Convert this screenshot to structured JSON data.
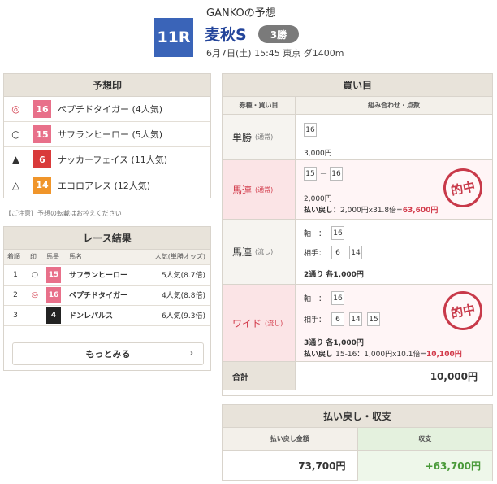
{
  "header": {
    "title": "GANKOの予想",
    "race_number": "11R",
    "race_name": "麦秋S",
    "grade": "3勝",
    "info": "6月7日(土) 15:45 東京 ダ1400m"
  },
  "yoso": {
    "heading": "予想印",
    "rows": [
      {
        "mark": "◎",
        "num": "16",
        "horse": "ペプチドタイガー",
        "pop": "(4人気)"
      },
      {
        "mark": "○",
        "num": "15",
        "horse": "サフランヒーロー",
        "pop": "(5人気)"
      },
      {
        "mark": "▲",
        "num": "6",
        "horse": "ナッカーフェイス",
        "pop": "(11人気)"
      },
      {
        "mark": "△",
        "num": "14",
        "horse": "エコロアレス",
        "pop": "(12人気)"
      }
    ]
  },
  "notice": "【ご注意】予想の転載はお控えください",
  "result": {
    "heading": "レース結果",
    "cols": [
      "着順",
      "印",
      "馬番",
      "馬名",
      "人気(単勝オッズ)"
    ],
    "rows": [
      {
        "rank": "1",
        "mark": "○",
        "num": "15",
        "horse": "サフランヒーロー",
        "pop": "5人気(8.7倍)"
      },
      {
        "rank": "2",
        "mark": "◎",
        "num": "16",
        "horse": "ペプチドタイガー",
        "pop": "4人気(8.8倍)"
      },
      {
        "rank": "3",
        "mark": "",
        "num": "4",
        "horse": "ドンレパルス",
        "pop": "6人気(9.3倍)"
      }
    ],
    "more_label": "もっとみる"
  },
  "kaime": {
    "heading": "買い目",
    "col_type": "券種・買い目",
    "col_combo": "組み合わせ・点数",
    "bets": [
      {
        "type": "単勝",
        "sub": "(通常)",
        "nums": [
          "16"
        ],
        "amount": "3,000円"
      },
      {
        "type": "馬連",
        "sub": "(通常)",
        "nums": [
          "15",
          "16"
        ],
        "sep": "ー",
        "amount": "2,000円",
        "pay_prefix": "払い戻し：",
        "pay_calc": "2,000円x31.8倍=",
        "pay_total": "63,600円",
        "stamp": "的中"
      },
      {
        "type": "馬連",
        "sub": "(流し)",
        "axis_label": "軸　：",
        "axis": [
          "16"
        ],
        "partner_label": "相手：",
        "partners": [
          "6",
          "14"
        ],
        "amount": "2通り 各1,000円"
      },
      {
        "type": "ワイド",
        "sub": "(流し)",
        "axis_label": "軸　：",
        "axis": [
          "16"
        ],
        "partner_label": "相手：",
        "partners": [
          "6",
          "14",
          "15"
        ],
        "amount": "3通り 各1,000円",
        "pay_prefix": "払い戻し",
        "pay_calc": "15-16：1,000円x10.1倍=",
        "pay_total": "10,100円",
        "stamp": "的中"
      }
    ],
    "total_label": "合計",
    "total_value": "10,000円"
  },
  "payout": {
    "heading": "払い戻し・収支",
    "col_pay": "払い戻し金額",
    "col_balance": "収支",
    "pay_value": "73,700円",
    "balance_value": "+63,700円"
  },
  "colors": {
    "race_box": "#3a64b8",
    "race_name": "#23449a",
    "hit_red": "#d23a4a",
    "balance_green": "#4a9a3a"
  }
}
